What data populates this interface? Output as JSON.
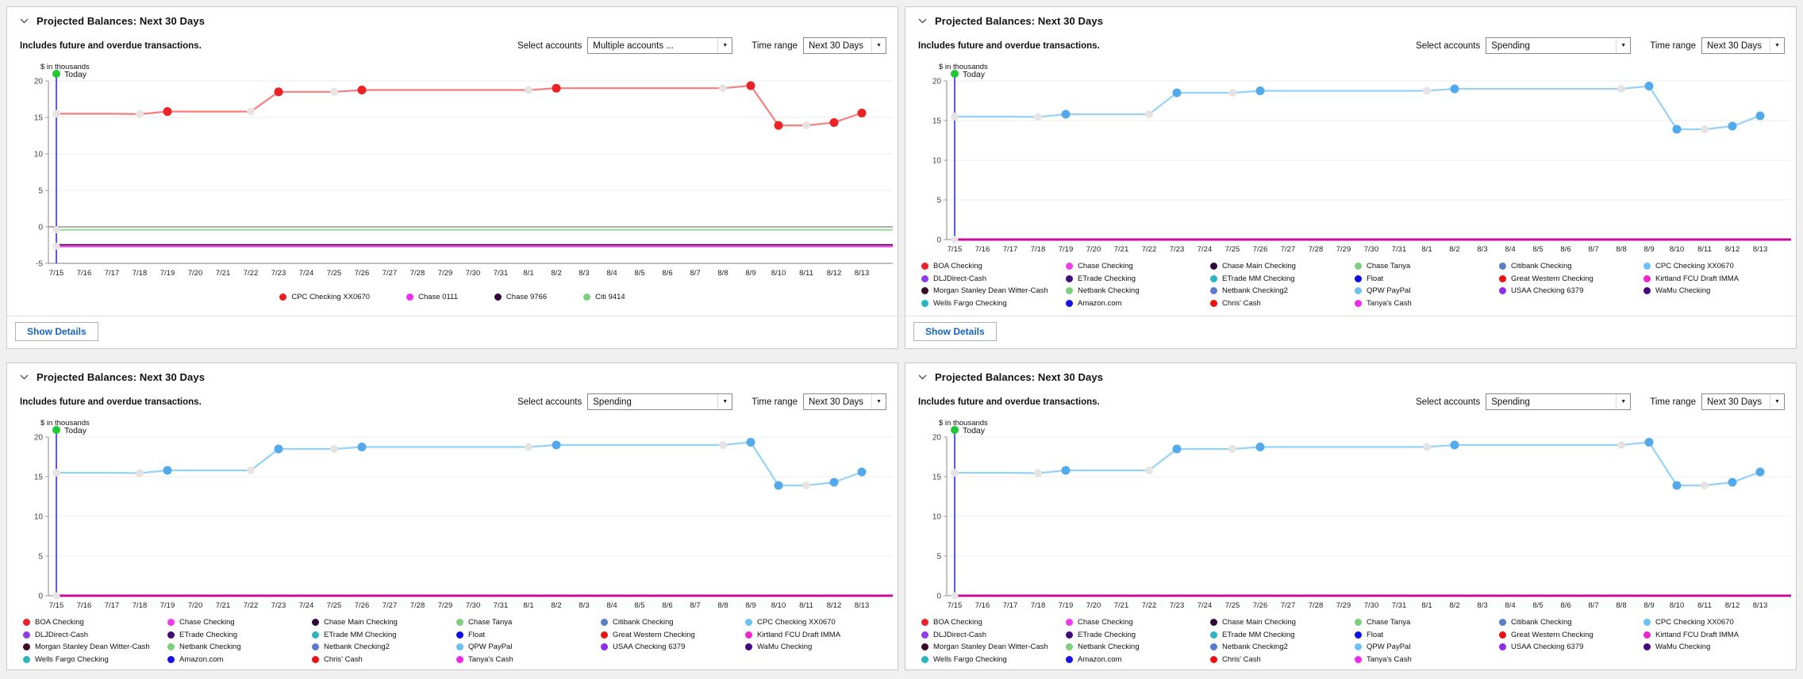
{
  "shared": {
    "title": "Projected Balances: Next 30 Days",
    "subtitle": "Includes future and overdue transactions.",
    "select_accounts_label": "Select accounts",
    "time_range_label": "Time range",
    "time_range_value": "Next 30 Days",
    "show_details_label": "Show Details",
    "y_axis_label": "$ in thousands",
    "today_label": "Today"
  },
  "panels": [
    {
      "id": "top-left",
      "select_accounts_value": "Multiple accounts ...",
      "variant": "multiple",
      "legend": "multiple",
      "show_details": true
    },
    {
      "id": "top-right",
      "select_accounts_value": "Spending",
      "variant": "spending",
      "legend": "spending",
      "show_details": true
    },
    {
      "id": "bottom-left",
      "select_accounts_value": "Spending",
      "variant": "spending",
      "legend": "spending",
      "show_details": false
    },
    {
      "id": "bottom-right",
      "select_accounts_value": "Spending",
      "variant": "spending",
      "legend": "spending",
      "show_details": false
    }
  ],
  "chart_data": {
    "type": "line",
    "title": "Projected Balances: Next 30 Days",
    "y_axis_label": "$ in thousands",
    "x_labels": [
      "7/15",
      "7/16",
      "7/17",
      "7/18",
      "7/19",
      "7/20",
      "7/21",
      "7/22",
      "7/23",
      "7/24",
      "7/25",
      "7/26",
      "7/27",
      "7/28",
      "7/29",
      "7/30",
      "7/31",
      "8/1",
      "8/2",
      "8/3",
      "8/4",
      "8/5",
      "8/6",
      "8/7",
      "8/8",
      "8/9",
      "8/10",
      "8/11",
      "8/12",
      "8/13"
    ],
    "y_ticks_multiple": [
      20,
      15,
      10,
      5,
      0,
      -5
    ],
    "y_ticks_spending": [
      20,
      15,
      10,
      5,
      0
    ],
    "series": [
      {
        "name": "CPC Checking XX0670",
        "unit": "thousands",
        "values": [
          15.5,
          15.5,
          15.5,
          15.45,
          15.8,
          15.8,
          15.8,
          15.8,
          18.5,
          18.5,
          18.5,
          18.75,
          18.75,
          18.75,
          18.75,
          18.75,
          18.75,
          18.75,
          19.0,
          19.0,
          19.0,
          19.0,
          19.0,
          19.0,
          19.0,
          19.35,
          13.9,
          13.9,
          14.3,
          15.6
        ]
      }
    ],
    "marker_bright_indices": [
      4,
      8,
      11,
      18,
      25,
      26,
      28,
      29
    ],
    "marker_pale_indices": [
      0,
      3,
      7,
      10,
      17,
      24,
      27
    ],
    "flat_lines_multiple": [
      {
        "name": "Citi 9414",
        "value": -0.4
      },
      {
        "name": "Chase 9766",
        "value": -2.45
      },
      {
        "name": "Chase 0111",
        "value": -2.65
      }
    ],
    "flat_line_spending": {
      "value": 0
    },
    "today_index": 0
  },
  "legend_multiple": [
    {
      "label": "CPC Checking XX0670",
      "color": "#ee1c25"
    },
    {
      "label": "Chase 0111",
      "color": "#f32bf3"
    },
    {
      "label": "Chase 9766",
      "color": "#31083a"
    },
    {
      "label": "Citi 9414",
      "color": "#7ccf7c"
    }
  ],
  "legend_spending": [
    {
      "label": "BOA Checking",
      "color": "#ee2128"
    },
    {
      "label": "Chase Checking",
      "color": "#ef3aee"
    },
    {
      "label": "Chase Main Checking",
      "color": "#31083a"
    },
    {
      "label": "Chase Tanya",
      "color": "#7ccf7c"
    },
    {
      "label": "Citibank Checking",
      "color": "#5b7fc4"
    },
    {
      "label": "CPC Checking XX0670",
      "color": "#6cc0f2"
    },
    {
      "label": "DLJDirect-Cash",
      "color": "#8e3cf0"
    },
    {
      "label": "ETrade Checking",
      "color": "#3f0d7e"
    },
    {
      "label": "ETrade MM Checking",
      "color": "#2ab5c0"
    },
    {
      "label": "Float",
      "color": "#0d0dee"
    },
    {
      "label": "Great Western Checking",
      "color": "#ee1111"
    },
    {
      "label": "Kirtland FCU Draft IMMA",
      "color": "#f324cb"
    },
    {
      "label": "Morgan Stanley Dean Witter-Cash",
      "color": "#3c0b24"
    },
    {
      "label": "Netbank Checking",
      "color": "#7ccf7c"
    },
    {
      "label": "Netbank Checking2",
      "color": "#5c78cf"
    },
    {
      "label": "QPW PayPal",
      "color": "#6cc0f2"
    },
    {
      "label": "USAA Checking 6379",
      "color": "#8e2bef"
    },
    {
      "label": "WaMu Checking",
      "color": "#46087e"
    },
    {
      "label": "Wells Fargo Checking",
      "color": "#28b5c0"
    },
    {
      "label": "Amazon.com",
      "color": "#1512ee"
    },
    {
      "label": "Chris' Cash",
      "color": "#ee1111"
    },
    {
      "label": "Tanya's Cash",
      "color": "#f327ee"
    }
  ],
  "colors": {
    "page_background": "#f0f0f0",
    "panel_background": "#ffffff",
    "panel_border": "#c9c9c9",
    "grid_line": "#ececec",
    "zero_line": "#7d7d7d",
    "axis_line": "#9c9c9c",
    "tick_text": "#444444",
    "x_label_text": "#222222",
    "today_line": "#2228c8",
    "today_dot": "#1fc932",
    "pale_marker": "#e8e3e3",
    "red_series_line": "#f57e7e",
    "red_series_marker": "#ee2222",
    "blue_series_line": "#94d3f7",
    "blue_series_marker": "#52aaec",
    "magenta_zero_line": "#cc0a9e",
    "flat_green": "#a5dca5",
    "flat_dark": "#31083a",
    "flat_magenta": "#e83ae8",
    "accent_blue": "#1464c0"
  }
}
